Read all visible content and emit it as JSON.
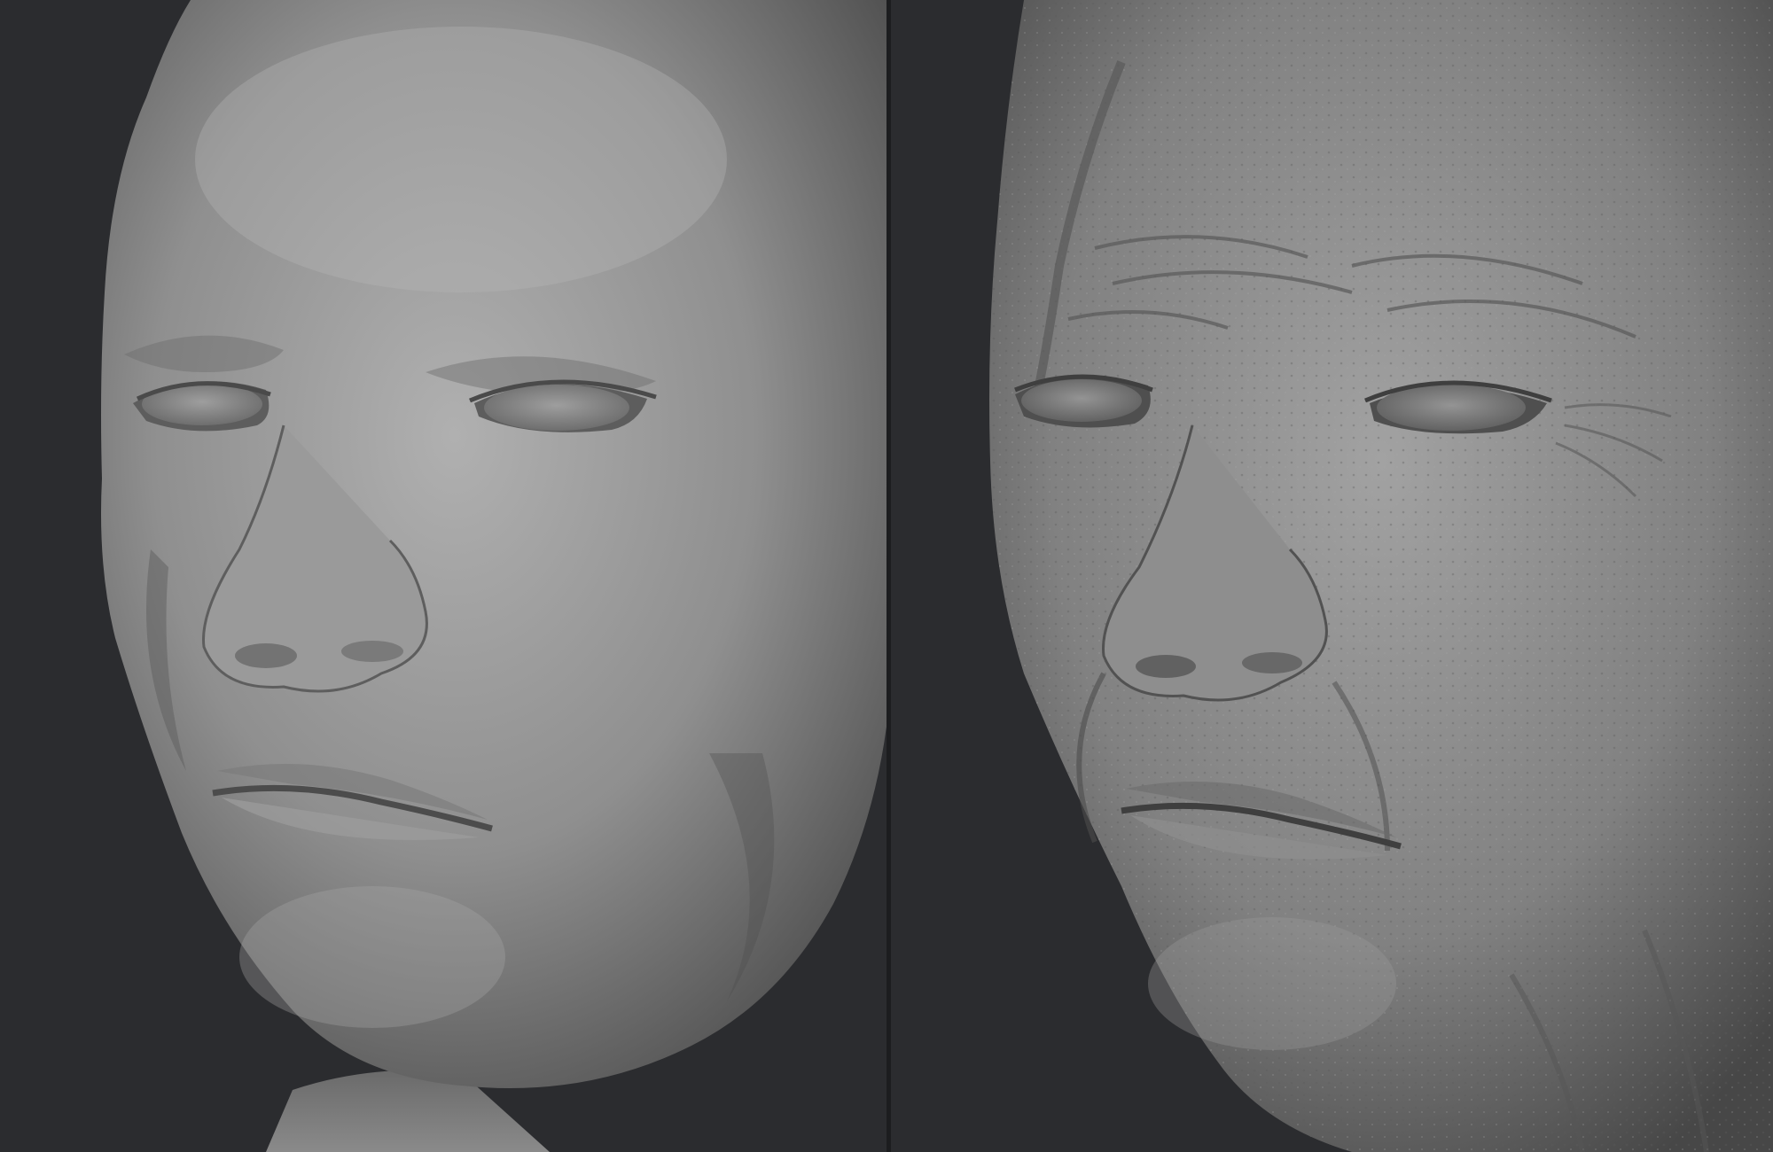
{
  "page": {
    "background": "#2a2b2e",
    "divider_color": "#1c1d1f"
  },
  "panels": [
    {
      "id": "left",
      "subject": "smooth-base-head",
      "skin_color": "#8e8e8e",
      "highlight_color": "#b3b3b3",
      "shadow_color": "#5a5a5a"
    },
    {
      "id": "right",
      "subject": "detailed-aged-head",
      "skin_color": "#7f7f7f",
      "highlight_color": "#a6a6a6",
      "shadow_color": "#4c4c4c"
    }
  ]
}
